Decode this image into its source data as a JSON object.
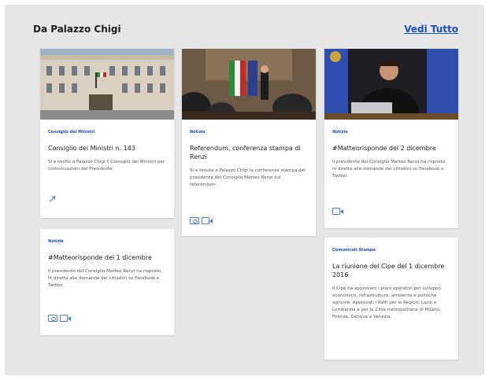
{
  "header": {
    "title": "Da Palazzo Chigi",
    "view_all": "Vedi Tutto"
  },
  "colors": {
    "accent": "#1a4fbf",
    "icon": "#4a7bd1",
    "background": "#e6e6e6"
  },
  "cards": [
    {
      "category": "Consiglio dei Ministri",
      "title": "Consiglio dei Ministri n. 143",
      "description": "Si è svolto a Palazzo Chigi il Consiglio dei Ministri per comunicazioni del Presidente.",
      "icons": [
        "external-link-icon"
      ]
    },
    {
      "category": "Notizie",
      "title": "Referendum, conferenza stampa di Renzi",
      "description": "Si è tenuta a Palazzo Chigi la conferenza stampa del presidente del Consiglio Matteo Renzi sul referendum.",
      "icons": [
        "photo-icon",
        "video-icon"
      ]
    },
    {
      "category": "Notizie",
      "title": "#Matteorisponde del 2 dicembre",
      "description": "Il presidente del Consiglio Matteo Renzi ha risposto in diretta alle domande dei cittadini su Facebook e Twitter.",
      "icons": [
        "video-icon"
      ]
    },
    {
      "category": "Notizie",
      "title": "#Matteorisponde del 1 dicembre",
      "description": "Il presidente del Consiglio Matteo Renzi ha risposto in diretta alle domande dei cittadini su Facebook e Twitter.",
      "icons": [
        "photo-icon",
        "video-icon"
      ]
    },
    {
      "category": "Comunicati Stampa",
      "title": "La riunione del Cipe del 1 dicembre 2016",
      "description": "Il Cipe ha approvato i piani operativi per sviluppo economico, infrastrutture, ambiente e politiche agricole. Approvati i Patti per le Regioni Lazio e Lombardia e per le Città metropolitane di Milano, Firenze, Genova e Venezia.",
      "icons": []
    }
  ]
}
